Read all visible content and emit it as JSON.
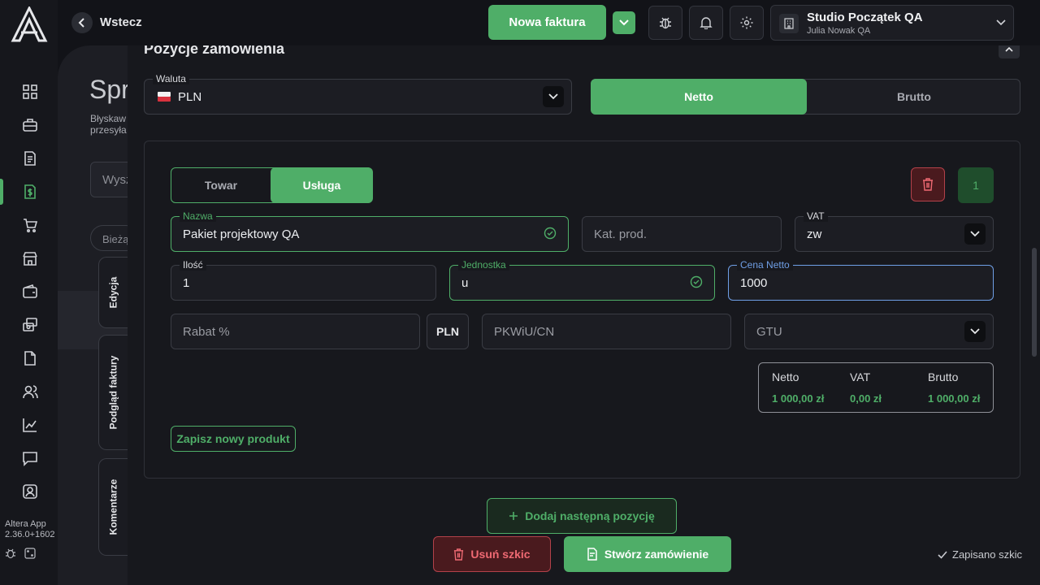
{
  "topbar": {
    "back_label": "Wstecz",
    "new_invoice_label": "Nowa faktura",
    "company_name": "Studio Początek QA",
    "company_user": "Julia Nowak QA"
  },
  "sidebar": {
    "items": [
      "dashboard-icon",
      "briefcase-icon",
      "document-icon",
      "invoice-dollar-icon",
      "cart-icon",
      "store-icon",
      "wallet-icon",
      "payments-icon",
      "file-icon",
      "users-icon",
      "chart-icon",
      "chat-icon",
      "account-icon"
    ],
    "active_index": 3,
    "app_name": "Altera App",
    "app_version": "2.36.0+1602"
  },
  "background_page": {
    "title": "Spr",
    "subtitle_line1": "Błyskaw",
    "subtitle_line2": "przesyła",
    "search_placeholder": "Wysz",
    "filter_chip": "Bieżą",
    "side_tabs": [
      "Edycja",
      "Podgląd faktury",
      "Komentarze"
    ]
  },
  "modal": {
    "section_title": "Pozycje zamówienia",
    "currency": {
      "label": "Waluta",
      "value": "PLN"
    },
    "net_gross": {
      "options": [
        "Netto",
        "Brutto"
      ],
      "selected": "Netto"
    },
    "item_type": {
      "options": [
        "Towar",
        "Usługa"
      ],
      "selected": "Usługa"
    },
    "item_number": "1",
    "fields": {
      "name": {
        "label": "Nazwa",
        "value": "Pakiet projektowy QA"
      },
      "category": {
        "placeholder": "Kat. prod."
      },
      "vat": {
        "label": "VAT",
        "value": "zw"
      },
      "quantity": {
        "label": "Ilość",
        "value": "1"
      },
      "unit": {
        "label": "Jednostka",
        "value": "u"
      },
      "net_price": {
        "label": "Cena Netto",
        "value": "1000"
      },
      "discount": {
        "placeholder": "Rabat %"
      },
      "discount_currency": "PLN",
      "pkwiu": {
        "placeholder": "PKWiU/CN"
      },
      "gtu": {
        "placeholder": "GTU"
      }
    },
    "summary": {
      "headers": [
        "Netto",
        "VAT",
        "Brutto"
      ],
      "values": [
        "1 000,00 zł",
        "0,00 zł",
        "1 000,00 zł"
      ]
    },
    "save_product_label": "Zapisz nowy produkt",
    "add_position_label": "Dodaj następną pozycję"
  },
  "footer": {
    "delete_draft_label": "Usuń szkic",
    "create_order_label": "Stwórz zamówienie",
    "saved_status": "Zapisano szkic"
  },
  "colors": {
    "accent": "#4fae68",
    "danger": "#b3414a",
    "focus": "#6f9fe6"
  }
}
